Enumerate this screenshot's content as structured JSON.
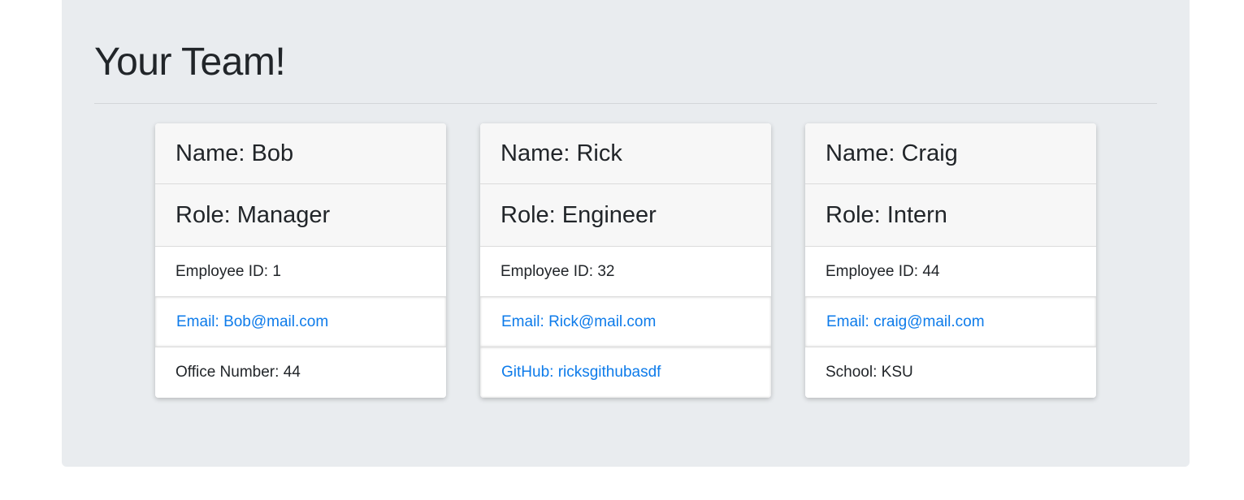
{
  "page": {
    "title": "Your Team!"
  },
  "colors": {
    "background": "#e9ecef",
    "card_header_bg": "#f7f7f7",
    "link": "#0d7bea",
    "text": "#212529"
  },
  "team": [
    {
      "name": "Name: Bob",
      "role": "Role: Manager",
      "id": "Employee ID: 1",
      "email": "Email: Bob@mail.com",
      "extra": "Office Number: 44"
    },
    {
      "name": "Name: Rick",
      "role": "Role: Engineer",
      "id": "Employee ID: 32",
      "email": "Email: Rick@mail.com",
      "extra": "GitHub: ricksgithubasdf"
    },
    {
      "name": "Name: Craig",
      "role": "Role: Intern",
      "id": "Employee ID: 44",
      "email": "Email: craig@mail.com",
      "extra": "School: KSU"
    }
  ]
}
